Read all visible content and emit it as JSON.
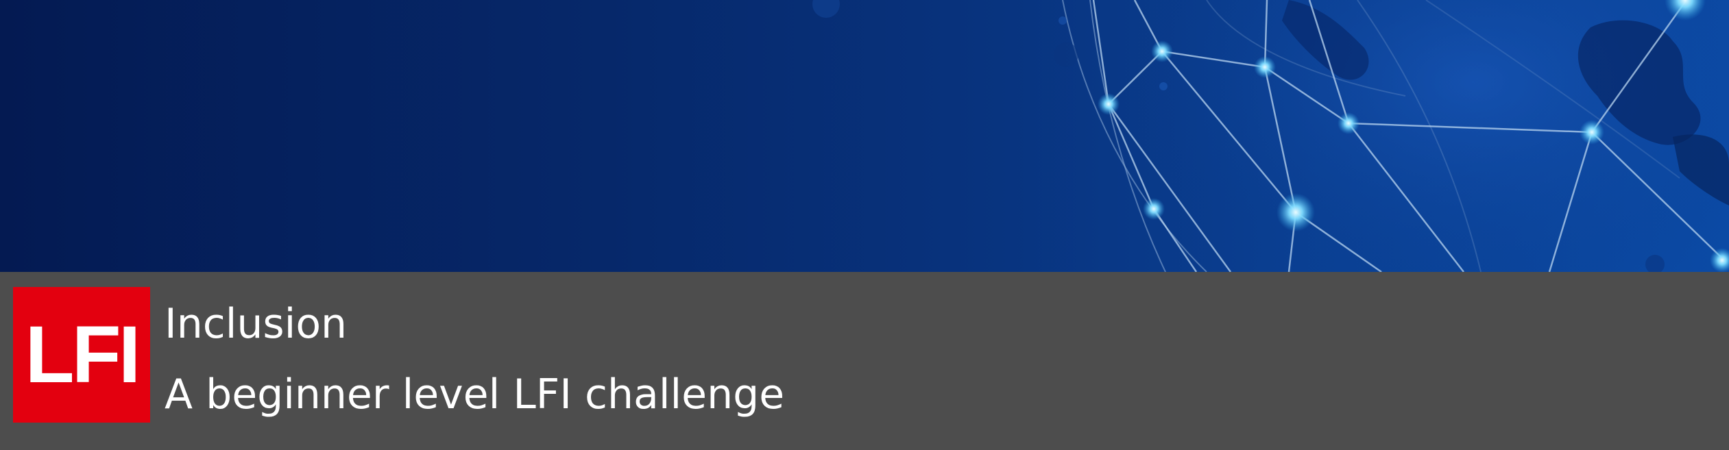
{
  "banner": {
    "icon": "network-globe"
  },
  "challenge": {
    "logo_text": "LFI",
    "title": "Inclusion",
    "description": "A beginner level LFI challenge"
  },
  "colors": {
    "logo_background": "#e3000f",
    "info_bar_background": "#4d4d4d",
    "banner_dark": "#041a52",
    "banner_light": "#0b4aa5",
    "node_glow": "#7fdcff"
  }
}
